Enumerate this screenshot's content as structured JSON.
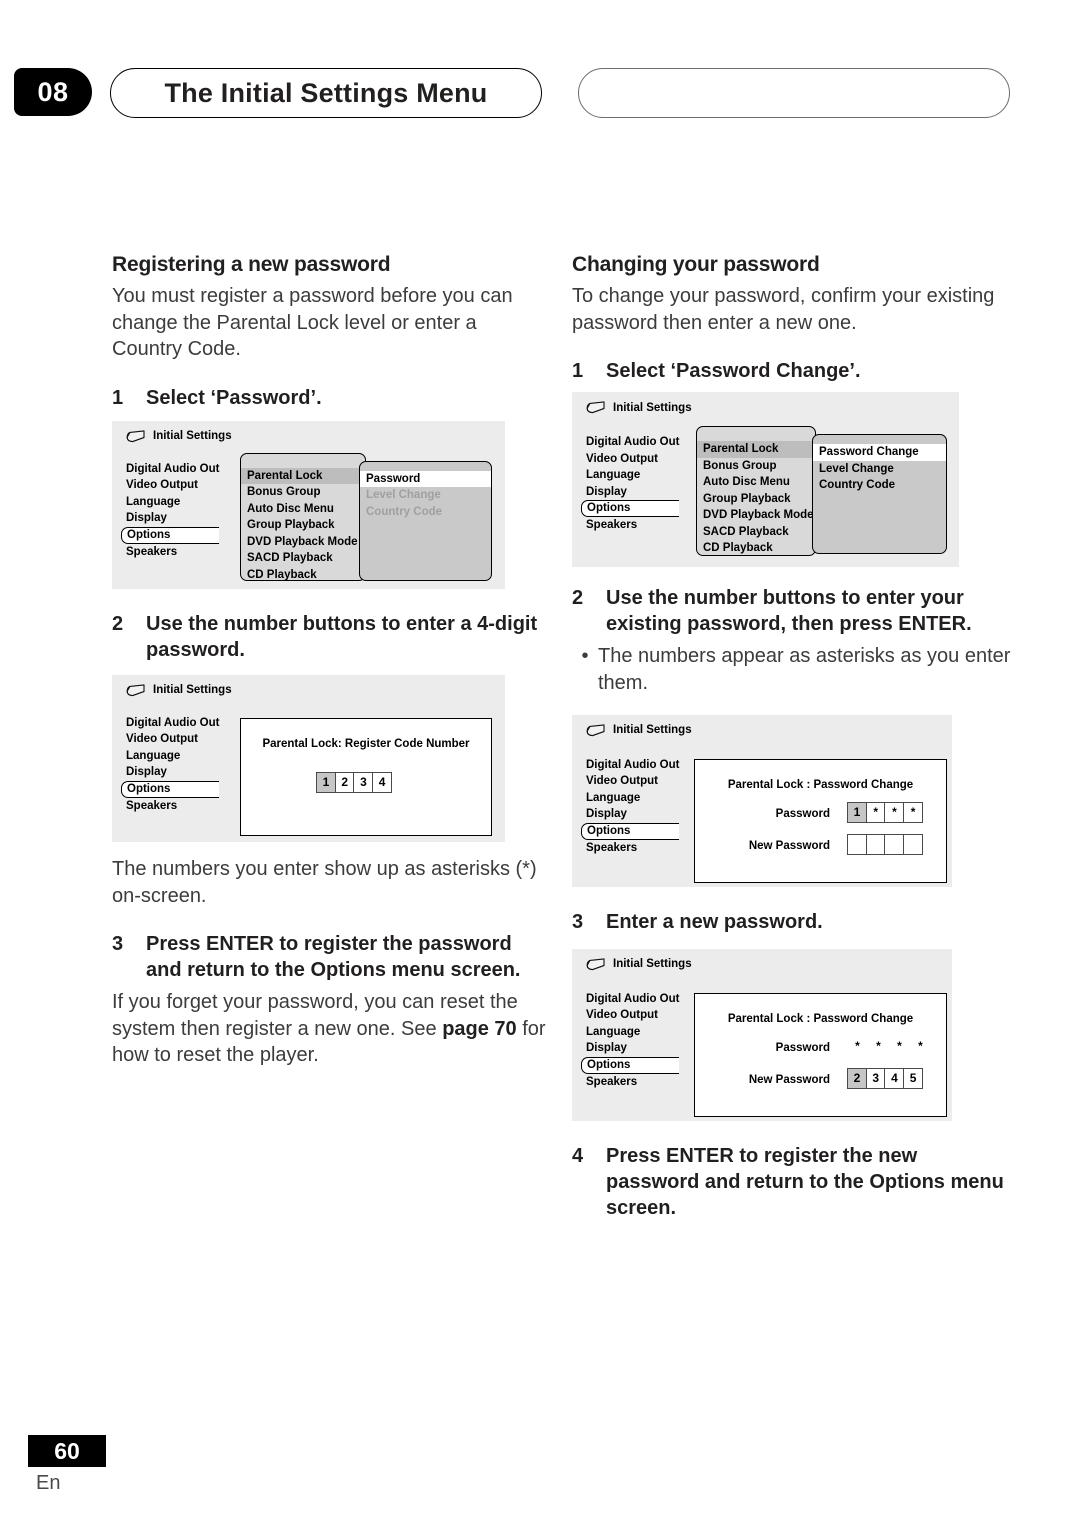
{
  "header": {
    "chapter_number": "08",
    "chapter_title": "The Initial Settings Menu"
  },
  "footer": {
    "page_number": "60",
    "language_code": "En"
  },
  "left_column": {
    "section_title": "Registering a new password",
    "intro": "You must register a password before you can change the Parental Lock level or enter a Country Code.",
    "step1": {
      "num": "1",
      "text": "Select ‘Password’."
    },
    "step2": {
      "num": "2",
      "text": "Use the number buttons to enter a 4-digit password."
    },
    "after_step2": "The numbers you enter show up as asterisks (*) on-screen.",
    "step3": {
      "num": "3",
      "text": "Press ENTER to register the password and return to the Options menu screen."
    },
    "after_step3_a": "If you forget your password, you can reset the system then register a new one. See ",
    "after_step3_link": "page 70",
    "after_step3_b": " for how to reset the player."
  },
  "right_column": {
    "section_title": "Changing your password",
    "intro": "To change your password, confirm your existing password then enter a new one.",
    "step1": {
      "num": "1",
      "text": "Select ‘Password Change’."
    },
    "step2": {
      "num": "2",
      "text": "Use the number buttons to enter your existing password, then press ENTER."
    },
    "step2_bullet": "The numbers appear as asterisks as you enter them.",
    "step3": {
      "num": "3",
      "text": "Enter a new password."
    },
    "step4": {
      "num": "4",
      "text": "Press ENTER to register the new password and return to the Options menu screen."
    }
  },
  "osd_common": {
    "title": "Initial Settings",
    "disc_icon": "disc-icon",
    "root_items": [
      "Digital Audio Out",
      "Video Output",
      "Language",
      "Display",
      "Options",
      "Speakers"
    ],
    "root_selected": "Options",
    "options_items": [
      "Parental Lock",
      "Bonus Group",
      "Auto Disc Menu",
      "Group Playback",
      "DVD Playback Mode",
      "SACD Playback",
      "CD Playback"
    ],
    "options_highlighted": "Parental Lock"
  },
  "diagram_1": {
    "title": "Initial Settings",
    "root_items": [
      "Digital Audio Out",
      "Video Output",
      "Language",
      "Display",
      "Options",
      "Speakers"
    ],
    "options_items": [
      "Parental Lock",
      "Bonus Group",
      "Auto Disc Menu",
      "Group Playback",
      "DVD Playback Mode",
      "SACD Playback",
      "CD Playback"
    ],
    "parental_items": [
      {
        "label": "Password",
        "state": "highlighted"
      },
      {
        "label": "Level Change",
        "state": "dimmed"
      },
      {
        "label": "Country Code",
        "state": "dimmed"
      }
    ]
  },
  "diagram_2": {
    "title": "Initial Settings",
    "root_items": [
      "Digital Audio Out",
      "Video Output",
      "Language",
      "Display",
      "Options",
      "Speakers"
    ],
    "dialog_title": "Parental Lock: Register Code Number",
    "digits": [
      {
        "value": "1",
        "state": "cursor"
      },
      {
        "value": "2",
        "state": "normal"
      },
      {
        "value": "3",
        "state": "normal"
      },
      {
        "value": "4",
        "state": "normal"
      }
    ]
  },
  "diagram_3": {
    "title": "Initial Settings",
    "root_items": [
      "Digital Audio Out",
      "Video Output",
      "Language",
      "Display",
      "Options",
      "Speakers"
    ],
    "options_items": [
      "Parental Lock",
      "Bonus Group",
      "Auto Disc Menu",
      "Group Playback",
      "DVD Playback Mode",
      "SACD Playback",
      "CD Playback"
    ],
    "parental_items": [
      {
        "label": "Password Change",
        "state": "highlighted"
      },
      {
        "label": "Level Change",
        "state": "normal"
      },
      {
        "label": "Country Code",
        "state": "normal"
      }
    ]
  },
  "diagram_4": {
    "title": "Initial Settings",
    "root_items": [
      "Digital Audio Out",
      "Video Output",
      "Language",
      "Display",
      "Options",
      "Speakers"
    ],
    "dialog_title": "Parental Lock : Password Change",
    "password_label": "Password",
    "new_password_label": "New Password",
    "password_digits": [
      {
        "value": "1",
        "state": "cursor"
      },
      {
        "value": "*",
        "state": "normal"
      },
      {
        "value": "*",
        "state": "normal"
      },
      {
        "value": "*",
        "state": "normal"
      }
    ],
    "new_password_digits": [
      {
        "value": "",
        "state": "empty"
      },
      {
        "value": "",
        "state": "empty"
      },
      {
        "value": "",
        "state": "empty"
      },
      {
        "value": "",
        "state": "empty"
      }
    ]
  },
  "diagram_5": {
    "title": "Initial Settings",
    "root_items": [
      "Digital Audio Out",
      "Video Output",
      "Language",
      "Display",
      "Options",
      "Speakers"
    ],
    "dialog_title": "Parental Lock : Password Change",
    "password_label": "Password",
    "new_password_label": "New Password",
    "password_stars": [
      "*",
      "*",
      "*",
      "*"
    ],
    "new_password_digits": [
      {
        "value": "2",
        "state": "cursor"
      },
      {
        "value": "3",
        "state": "normal"
      },
      {
        "value": "4",
        "state": "normal"
      },
      {
        "value": "5",
        "state": "normal"
      }
    ]
  },
  "colors": {
    "osd_background": "#ececec",
    "panel_level2": "#d9d9d9",
    "panel_level3": "#c9c9c9",
    "highlight_row": "#ffffff",
    "dim_text": "#a0a0a0",
    "accent_black": "#000000"
  }
}
